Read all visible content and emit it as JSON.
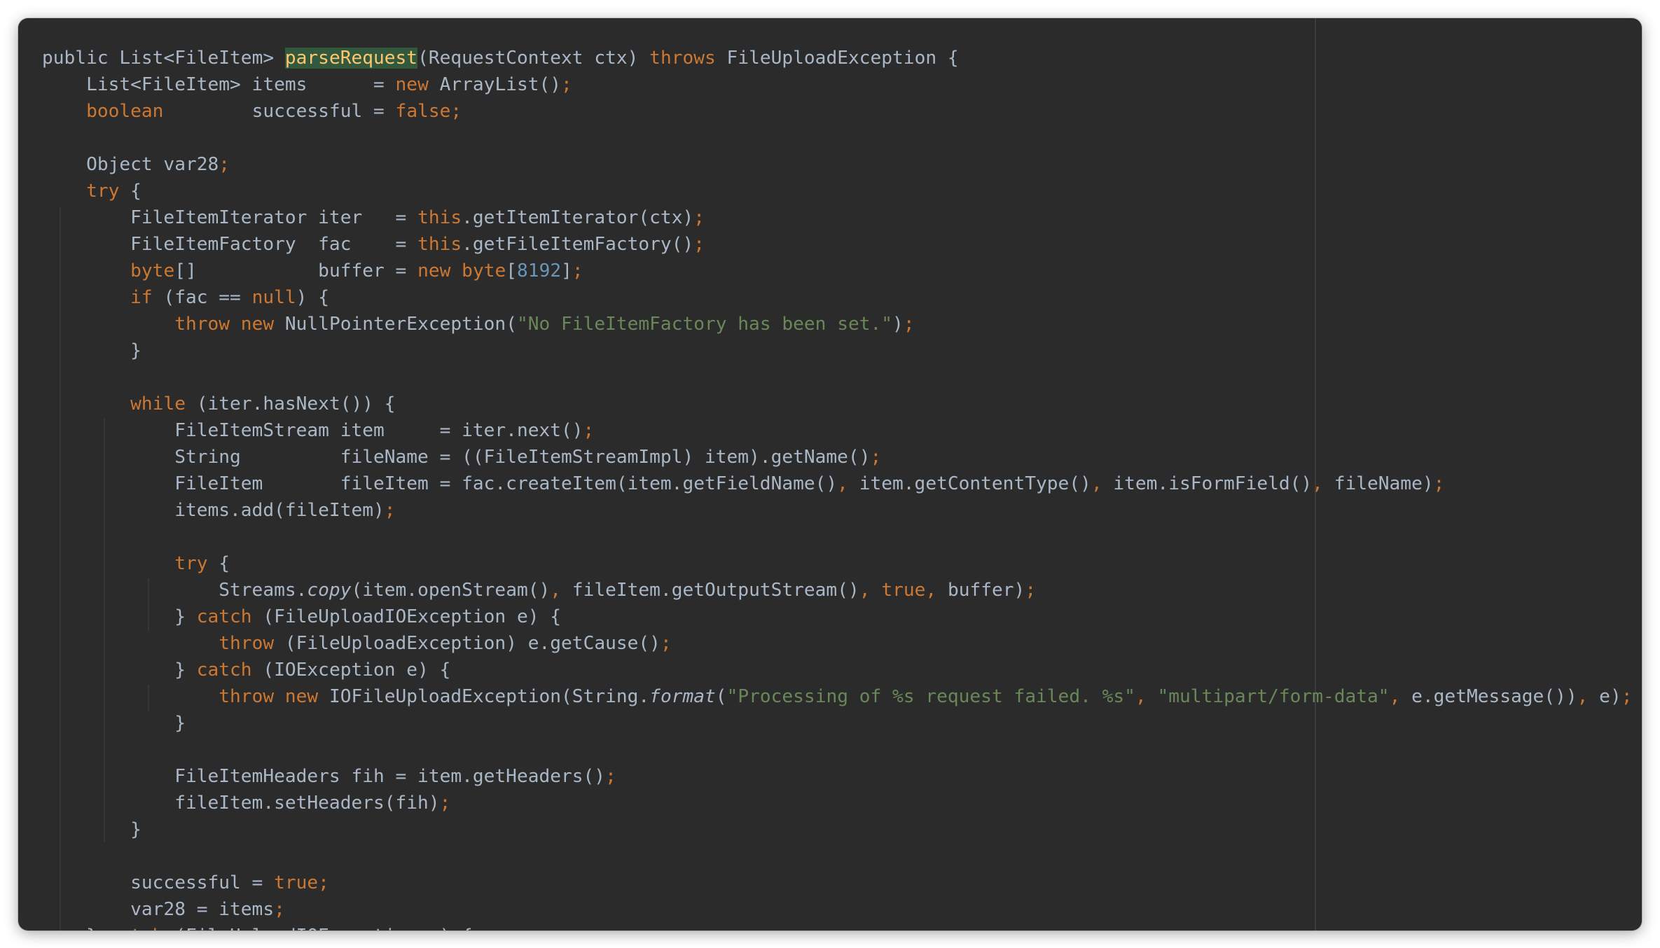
{
  "editor": {
    "language": "java",
    "lines": [
      [
        [
          "t",
          "public "
        ],
        [
          "t",
          "List<FileItem> "
        ],
        [
          "hl",
          "parseRequest"
        ],
        [
          "t",
          "(RequestContext ctx) "
        ],
        [
          "kw",
          "throws"
        ],
        [
          "t",
          " FileUploadException {"
        ]
      ],
      [
        [
          "t",
          "    List<FileItem> items      = "
        ],
        [
          "kw",
          "new"
        ],
        [
          "t",
          " ArrayList()"
        ],
        [
          "pn",
          ";"
        ]
      ],
      [
        [
          "t",
          "    "
        ],
        [
          "kw",
          "boolean"
        ],
        [
          "t",
          "        successful = "
        ],
        [
          "kw",
          "false"
        ],
        [
          "pn",
          ";"
        ]
      ],
      [],
      [
        [
          "t",
          "    Object var28"
        ],
        [
          "pn",
          ";"
        ]
      ],
      [
        [
          "t",
          "    "
        ],
        [
          "kw",
          "try"
        ],
        [
          "t",
          " {"
        ]
      ],
      [
        [
          "t",
          "        FileItemIterator iter   = "
        ],
        [
          "kw",
          "this"
        ],
        [
          "t",
          ".getItemIterator(ctx)"
        ],
        [
          "pn",
          ";"
        ]
      ],
      [
        [
          "t",
          "        FileItemFactory  fac    = "
        ],
        [
          "kw",
          "this"
        ],
        [
          "t",
          ".getFileItemFactory()"
        ],
        [
          "pn",
          ";"
        ]
      ],
      [
        [
          "t",
          "        "
        ],
        [
          "kw",
          "byte"
        ],
        [
          "t",
          "[]           buffer = "
        ],
        [
          "kw",
          "new"
        ],
        [
          "t",
          " "
        ],
        [
          "kw",
          "byte"
        ],
        [
          "t",
          "["
        ],
        [
          "num",
          "8192"
        ],
        [
          "t",
          "]"
        ],
        [
          "pn",
          ";"
        ]
      ],
      [
        [
          "t",
          "        "
        ],
        [
          "kw",
          "if"
        ],
        [
          "t",
          " (fac == "
        ],
        [
          "kw",
          "null"
        ],
        [
          "t",
          ") {"
        ]
      ],
      [
        [
          "t",
          "            "
        ],
        [
          "kw",
          "throw new"
        ],
        [
          "t",
          " NullPointerException("
        ],
        [
          "str",
          "\"No FileItemFactory has been set.\""
        ],
        [
          "t",
          ")"
        ],
        [
          "pn",
          ";"
        ]
      ],
      [
        [
          "t",
          "        }"
        ]
      ],
      [],
      [
        [
          "t",
          "        "
        ],
        [
          "kw",
          "while"
        ],
        [
          "t",
          " (iter.hasNext()) {"
        ]
      ],
      [
        [
          "t",
          "            FileItemStream item     = iter.next()"
        ],
        [
          "pn",
          ";"
        ]
      ],
      [
        [
          "t",
          "            String         fileName = ((FileItemStreamImpl) item).getName()"
        ],
        [
          "pn",
          ";"
        ]
      ],
      [
        [
          "t",
          "            FileItem       fileItem = fac.createItem(item.getFieldName()"
        ],
        [
          "pn",
          ","
        ],
        [
          "t",
          " item.getContentType()"
        ],
        [
          "pn",
          ","
        ],
        [
          "t",
          " item.isFormField()"
        ],
        [
          "pn",
          ","
        ],
        [
          "t",
          " fileName)"
        ],
        [
          "pn",
          ";"
        ]
      ],
      [
        [
          "t",
          "            items.add(fileItem)"
        ],
        [
          "pn",
          ";"
        ]
      ],
      [],
      [
        [
          "t",
          "            "
        ],
        [
          "kw",
          "try"
        ],
        [
          "t",
          " {"
        ]
      ],
      [
        [
          "t",
          "                Streams."
        ],
        [
          "it",
          "copy"
        ],
        [
          "t",
          "(item.openStream()"
        ],
        [
          "pn",
          ","
        ],
        [
          "t",
          " fileItem.getOutputStream()"
        ],
        [
          "pn",
          ","
        ],
        [
          "t",
          " "
        ],
        [
          "kw",
          "true"
        ],
        [
          "pn",
          ","
        ],
        [
          "t",
          " buffer)"
        ],
        [
          "pn",
          ";"
        ]
      ],
      [
        [
          "t",
          "            } "
        ],
        [
          "kw",
          "catch"
        ],
        [
          "t",
          " (FileUploadIOException e) {"
        ]
      ],
      [
        [
          "t",
          "                "
        ],
        [
          "kw",
          "throw"
        ],
        [
          "t",
          " (FileUploadException) e.getCause()"
        ],
        [
          "pn",
          ";"
        ]
      ],
      [
        [
          "t",
          "            } "
        ],
        [
          "kw",
          "catch"
        ],
        [
          "t",
          " (IOException e) {"
        ]
      ],
      [
        [
          "t",
          "                "
        ],
        [
          "kw",
          "throw new"
        ],
        [
          "t",
          " IOFileUploadException(String."
        ],
        [
          "it",
          "format"
        ],
        [
          "t",
          "("
        ],
        [
          "str",
          "\"Processing of %s request failed. %s\""
        ],
        [
          "pn",
          ","
        ],
        [
          "t",
          " "
        ],
        [
          "str",
          "\"multipart/form-data\""
        ],
        [
          "pn",
          ","
        ],
        [
          "t",
          " e.getMessage())"
        ],
        [
          "pn",
          ","
        ],
        [
          "t",
          " e)"
        ],
        [
          "pn",
          ";"
        ]
      ],
      [
        [
          "t",
          "            }"
        ]
      ],
      [],
      [
        [
          "t",
          "            FileItemHeaders fih = item.getHeaders()"
        ],
        [
          "pn",
          ";"
        ]
      ],
      [
        [
          "t",
          "            fileItem.setHeaders(fih)"
        ],
        [
          "pn",
          ";"
        ]
      ],
      [
        [
          "t",
          "        }"
        ]
      ],
      [],
      [
        [
          "t",
          "        successful = "
        ],
        [
          "kw",
          "true"
        ],
        [
          "pn",
          ";"
        ]
      ],
      [
        [
          "t",
          "        var28 = items"
        ],
        [
          "pn",
          ";"
        ]
      ],
      [
        [
          "t",
          "    } "
        ],
        [
          "kw",
          "catch"
        ],
        [
          "t",
          " (FileUploadIOException e) {"
        ]
      ]
    ]
  },
  "colors": {
    "background": "#2b2b2b",
    "default_text": "#a9b7c6",
    "keyword": "#cc7832",
    "string": "#6a8759",
    "number": "#6897bb",
    "method_highlight_text": "#ffc66d",
    "method_highlight_bg": "#32593d"
  }
}
